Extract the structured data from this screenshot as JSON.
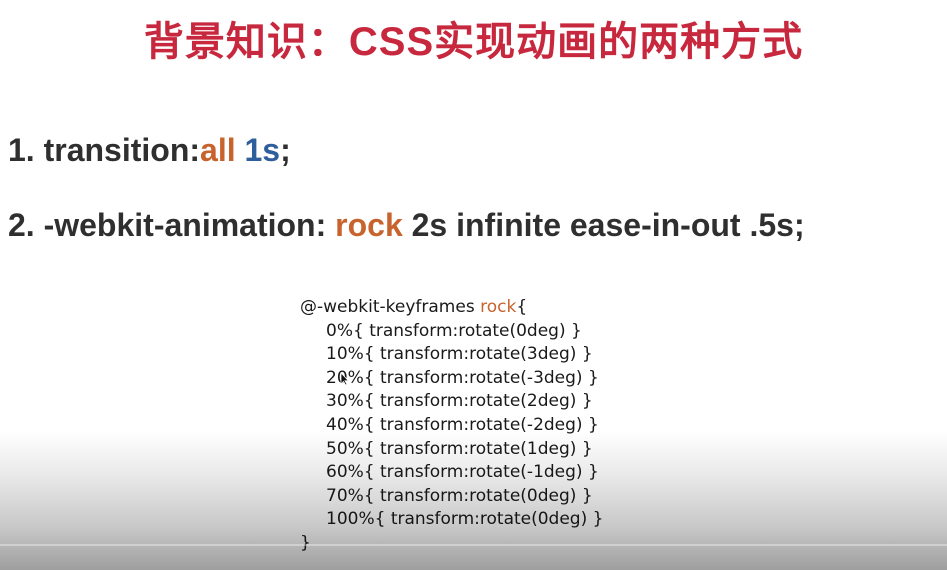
{
  "title": "背景知识：CSS实现动画的两种方式",
  "line1": {
    "prefix": "1. transition:",
    "all": "all",
    "space": " ",
    "duration": "1s",
    "suffix": ";"
  },
  "line2": {
    "prefix": "2. -webkit-animation: ",
    "name": "rock",
    "rest": " 2s infinite ease-in-out .5s;"
  },
  "code": {
    "header_prefix": "@-webkit-keyframes ",
    "header_name": "rock",
    "header_brace": "{",
    "frames": [
      "0%{ transform:rotate(0deg) }",
      "10%{ transform:rotate(3deg) }",
      "20%{ transform:rotate(-3deg) }",
      "30%{ transform:rotate(2deg) }",
      "40%{ transform:rotate(-2deg) }",
      "50%{ transform:rotate(1deg) }",
      "60%{ transform:rotate(-1deg) }",
      "70%{ transform:rotate(0deg) }",
      "100%{ transform:rotate(0deg) }"
    ],
    "closing": "}"
  },
  "colors": {
    "title": "#c8283e",
    "keyword": "#c8632d",
    "value": "#2f5e9c",
    "text": "#2f2f2f"
  },
  "icons": {
    "cursor": "mouse-pointer-icon"
  }
}
